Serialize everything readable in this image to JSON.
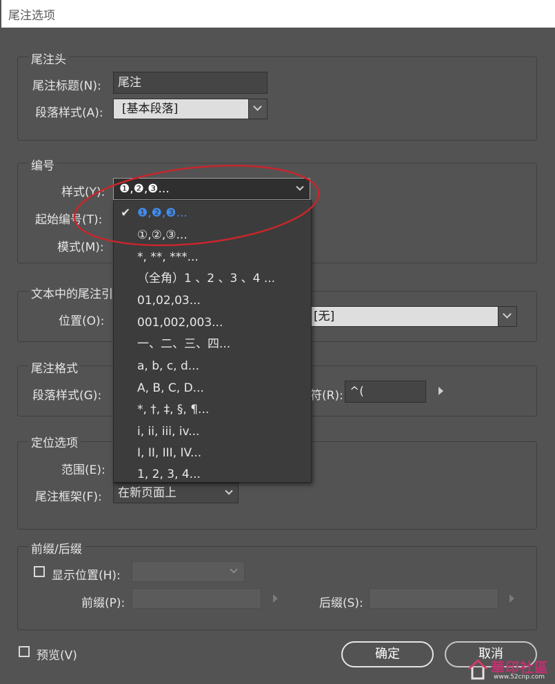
{
  "window": {
    "title": "尾注选项"
  },
  "header_group": {
    "legend": "尾注头",
    "title_label": "尾注标题(N):",
    "title_value": "尾注",
    "para_style_label": "段落样式(A):",
    "para_style_value": "[基本段落]"
  },
  "numbering_group": {
    "legend": "编号",
    "style_label": "样式(Y):",
    "style_value": "❶,❷,❸...",
    "start_label": "起始编号(T):",
    "mode_label": "模式(M):",
    "style_options": [
      "❶,❷,❸...",
      "①,②,③...",
      "*, **, ***...",
      "（全角）1 、2 、3 、4 ...",
      "01,02,03...",
      "001,002,003...",
      "一、二、三、四...",
      "a, b, c, d...",
      "A, B, C, D...",
      "*, †, ‡, §, ¶...",
      "i, ii, iii, iv...",
      "I, II, III, IV...",
      "1, 2, 3, 4..."
    ],
    "selected_index": 0
  },
  "reference_group": {
    "legend": "文本中的尾注引",
    "position_label": "位置(O):",
    "char_style_value": "[无]"
  },
  "format_group": {
    "legend": "尾注格式",
    "para_style_label": "段落样式(G):",
    "separator_label": "符(R):",
    "separator_value": "^("
  },
  "placement_group": {
    "legend": "定位选项",
    "scope_label": "范围(E):",
    "frame_label": "尾注框架(F):",
    "frame_value": "在新页面上"
  },
  "prefix_group": {
    "legend": "前缀/后缀",
    "show_label": "显示位置(H):",
    "prefix_label": "前缀(P):",
    "suffix_label": "后缀(S):"
  },
  "footer": {
    "preview_label": "预览(V)",
    "ok_label": "确定",
    "cancel_label": "取消"
  },
  "watermark": {
    "text": "華印社區",
    "url": "www.52cnp.com"
  },
  "colors": {
    "selected_blue": "#3f8ef0",
    "annotation_red": "#c8262c"
  }
}
